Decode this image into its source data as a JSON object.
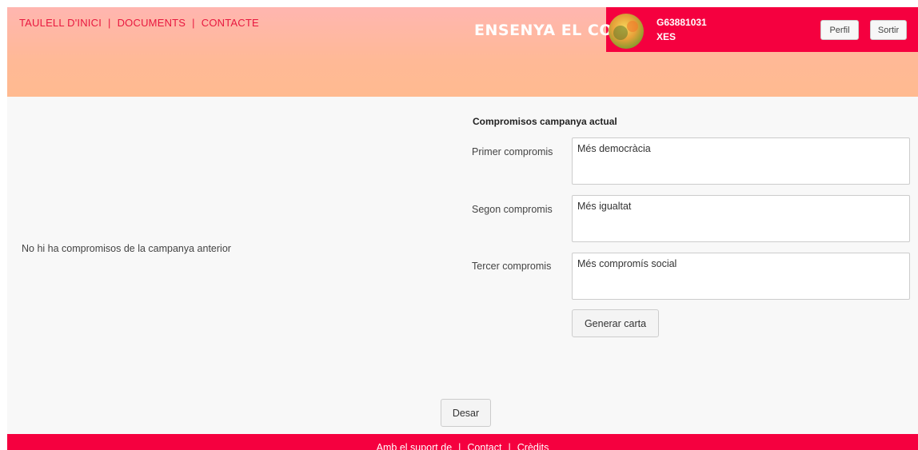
{
  "nav": {
    "home": "TAULELL D'INICI",
    "documents": "DOCUMENTS",
    "contact": "CONTACTE",
    "separator": "|"
  },
  "brand": {
    "text": "ENSENYA EL COR"
  },
  "user": {
    "id": "G63881031",
    "code": "XES"
  },
  "header_buttons": {
    "profile": "Perfil",
    "logout": "Sortir"
  },
  "previous": {
    "message": "No hi ha compromisos de la campanya anterior"
  },
  "current": {
    "title": "Compromisos campanya actual",
    "fields": [
      {
        "label": "Primer compromis",
        "value": "Més democràcia"
      },
      {
        "label": "Segon compromis",
        "value": "Més igualtat"
      },
      {
        "label": "Tercer compromis",
        "value": "Més compromís social"
      }
    ],
    "generate_label": "Generar carta"
  },
  "save_label": "Desar",
  "footer": {
    "support": "Amb el suport de",
    "contact": "Contact",
    "credits": "Crèdits",
    "separator": "|"
  },
  "colors": {
    "accent": "#f5003f",
    "header_gradient_top": "#ffb6b0",
    "header_gradient_bottom": "#ffba90"
  }
}
